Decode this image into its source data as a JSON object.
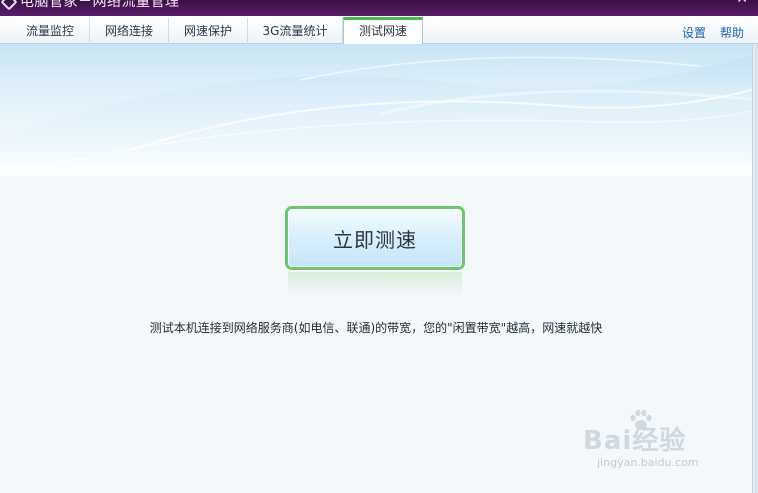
{
  "window": {
    "title": "电脑管家－网络流量管理"
  },
  "tabs": [
    {
      "label": "流量监控",
      "active": false
    },
    {
      "label": "网络连接",
      "active": false
    },
    {
      "label": "网速保护",
      "active": false
    },
    {
      "label": "3G流量统计",
      "active": false
    },
    {
      "label": "测试网速",
      "active": true
    }
  ],
  "toplinks": {
    "settings": "设置",
    "help": "帮助"
  },
  "main": {
    "button_label": "立即测速",
    "description": "测试本机连接到网络服务商(如电信、联通)的带宽，您的\"闲置带宽\"越高，网速就越快"
  },
  "watermark": {
    "text": "Bai经验",
    "url": "jingyan.baidu.com"
  },
  "colors": {
    "accent_green": "#6fc46f",
    "link_blue": "#1a64b5",
    "titlebar_purple": "#4a1657"
  },
  "icons": [
    "app-logo-icon",
    "close-icon",
    "baidu-paw-icon"
  ]
}
